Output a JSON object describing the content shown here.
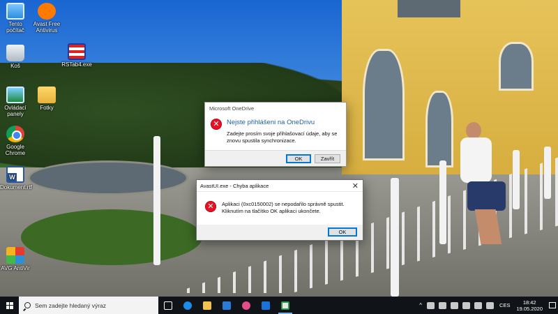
{
  "desktop": {
    "icons": [
      {
        "label": "Tento počítač",
        "icon": "computer-icon"
      },
      {
        "label": "Avast Free Antivirus",
        "icon": "avast-icon"
      },
      {
        "label": "Koš",
        "icon": "recycle-bin-icon"
      },
      {
        "label": "RSTab4.exe",
        "icon": "rstab-icon"
      },
      {
        "label": "Ovládací panely",
        "icon": "control-panel-icon"
      },
      {
        "label": "Fotky",
        "icon": "folder-icon"
      },
      {
        "label": "Google Chrome",
        "icon": "chrome-icon"
      },
      {
        "label": "Dokument.rtf",
        "icon": "word-document-icon"
      },
      {
        "label": "AVG AntiVir",
        "icon": "avg-icon"
      }
    ]
  },
  "onedrive_dialog": {
    "title": "Microsoft OneDrive",
    "headline": "Nejste přihlášeni na OneDrivu",
    "message": "Zadejte prosím svoje přihlašovací údaje, aby se znovu spustila synchronizace.",
    "ok_label": "OK",
    "close_label": "Zavřít"
  },
  "avast_error_dialog": {
    "title": "AvastUI.exe - Chyba aplikace",
    "message": "Aplikaci (0xc0150002) se nepodařilo správně spustit. Kliknutím na tlačítko OK aplikaci ukončete.",
    "ok_label": "OK",
    "close_symbol": "✕"
  },
  "taskbar": {
    "search_placeholder": "Sem zadejte hledaný výraz",
    "pinned_apps": [
      "task-view-icon",
      "edge-icon",
      "file-explorer-icon",
      "store-icon",
      "groove-music-icon",
      "mail-icon",
      "app-window-icon"
    ],
    "tray": {
      "chevron": "^",
      "language": "CES",
      "time": "18:42",
      "date": "19.05.2020"
    }
  },
  "colors": {
    "taskbar": "#101418",
    "error_red": "#e81123",
    "onedrive_headline": "#1b5fb0",
    "default_button_border": "#0078d7"
  }
}
